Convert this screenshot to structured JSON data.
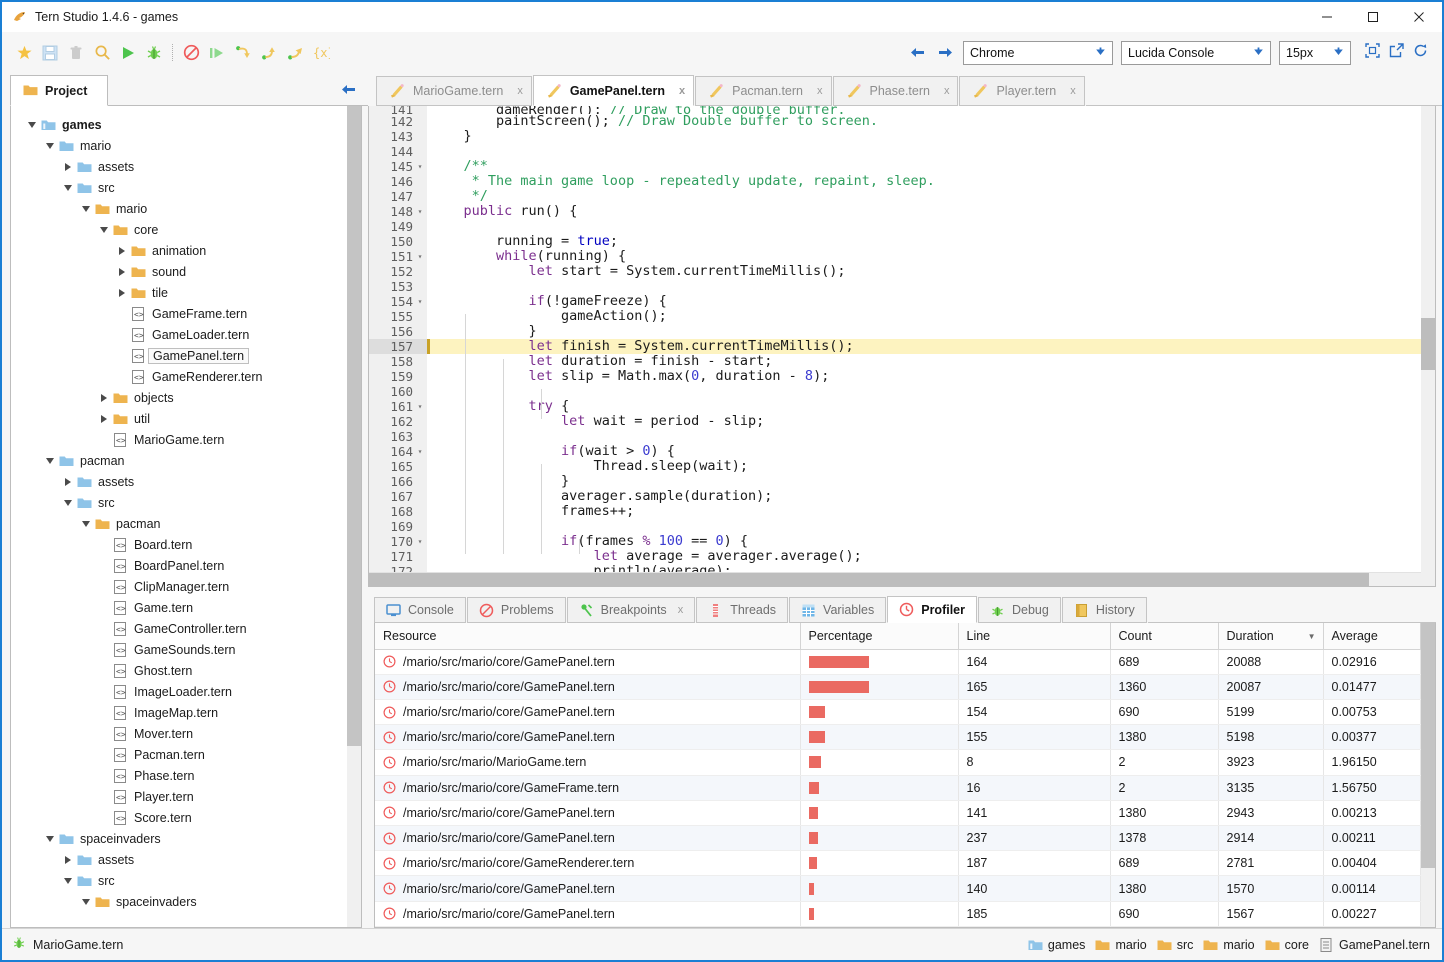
{
  "window": {
    "title": "Tern Studio 1.4.6 - games",
    "app_icon": "tern-bird-icon",
    "minimize_label": "—",
    "maximize_label": "□",
    "close_label": "✕"
  },
  "toolbar": {
    "icons": [
      {
        "name": "favorite-star-icon",
        "glyph": "star",
        "color": "#f5c242"
      },
      {
        "name": "save-icon",
        "glyph": "floppy",
        "color": "#cfe2f3"
      },
      {
        "name": "delete-icon",
        "glyph": "trash",
        "color": "#c9c9c9"
      },
      {
        "name": "search-icon",
        "glyph": "magnifier",
        "color": "#e8b84b"
      },
      {
        "name": "run-icon",
        "glyph": "play",
        "color": "#5cc45c"
      },
      {
        "name": "debug-icon",
        "glyph": "bug",
        "color": "#5cc45c"
      },
      {
        "name": "stop-icon",
        "glyph": "no-entry",
        "color": "#ef5b5b"
      },
      {
        "name": "resume-icon",
        "glyph": "resume",
        "color": "#8ed98e"
      },
      {
        "name": "step-over-icon",
        "glyph": "step-over",
        "color": "#5cc45c"
      },
      {
        "name": "step-in-icon",
        "glyph": "step-in",
        "color": "#5cc45c"
      },
      {
        "name": "step-out-icon",
        "glyph": "step-out",
        "color": "#5cc45c"
      },
      {
        "name": "evaluate-icon",
        "glyph": "braces-x",
        "color": "#f0c75e"
      }
    ],
    "nav_back": "◀",
    "nav_forward": "▶",
    "browser_select": {
      "value": "Chrome",
      "arrow": "⬇"
    },
    "font_select": {
      "value": "Lucida Console",
      "arrow": "⬇"
    },
    "size_select": {
      "value": "15px",
      "arrow": "⬇"
    },
    "right_icons": [
      {
        "name": "fit-window-icon"
      },
      {
        "name": "open-external-icon"
      },
      {
        "name": "refresh-icon"
      }
    ]
  },
  "sidebar": {
    "tab_label": "Project",
    "collapse_arrow": "◀",
    "tree": [
      {
        "depth": 0,
        "label": "games",
        "type": "root-folder",
        "state": "open",
        "bold": true
      },
      {
        "depth": 1,
        "label": "mario",
        "type": "blue-folder",
        "state": "open"
      },
      {
        "depth": 2,
        "label": "assets",
        "type": "blue-folder",
        "state": "closed"
      },
      {
        "depth": 2,
        "label": "src",
        "type": "blue-folder",
        "state": "open"
      },
      {
        "depth": 3,
        "label": "mario",
        "type": "pkg-folder",
        "state": "open"
      },
      {
        "depth": 4,
        "label": "core",
        "type": "pkg-folder",
        "state": "open"
      },
      {
        "depth": 5,
        "label": "animation",
        "type": "pkg-folder",
        "state": "closed"
      },
      {
        "depth": 5,
        "label": "sound",
        "type": "pkg-folder",
        "state": "closed"
      },
      {
        "depth": 5,
        "label": "tile",
        "type": "pkg-folder",
        "state": "closed"
      },
      {
        "depth": 5,
        "label": "GameFrame.tern",
        "type": "file",
        "state": "leaf"
      },
      {
        "depth": 5,
        "label": "GameLoader.tern",
        "type": "file",
        "state": "leaf"
      },
      {
        "depth": 5,
        "label": "GamePanel.tern",
        "type": "file",
        "state": "leaf",
        "selected": true
      },
      {
        "depth": 5,
        "label": "GameRenderer.tern",
        "type": "file",
        "state": "leaf"
      },
      {
        "depth": 4,
        "label": "objects",
        "type": "pkg-folder",
        "state": "closed"
      },
      {
        "depth": 4,
        "label": "util",
        "type": "pkg-folder",
        "state": "closed"
      },
      {
        "depth": 4,
        "label": "MarioGame.tern",
        "type": "file",
        "state": "leaf"
      },
      {
        "depth": 1,
        "label": "pacman",
        "type": "blue-folder",
        "state": "open"
      },
      {
        "depth": 2,
        "label": "assets",
        "type": "blue-folder",
        "state": "closed"
      },
      {
        "depth": 2,
        "label": "src",
        "type": "blue-folder",
        "state": "open"
      },
      {
        "depth": 3,
        "label": "pacman",
        "type": "pkg-folder",
        "state": "open"
      },
      {
        "depth": 4,
        "label": "Board.tern",
        "type": "file",
        "state": "leaf"
      },
      {
        "depth": 4,
        "label": "BoardPanel.tern",
        "type": "file",
        "state": "leaf"
      },
      {
        "depth": 4,
        "label": "ClipManager.tern",
        "type": "file",
        "state": "leaf"
      },
      {
        "depth": 4,
        "label": "Game.tern",
        "type": "file",
        "state": "leaf"
      },
      {
        "depth": 4,
        "label": "GameController.tern",
        "type": "file",
        "state": "leaf"
      },
      {
        "depth": 4,
        "label": "GameSounds.tern",
        "type": "file",
        "state": "leaf"
      },
      {
        "depth": 4,
        "label": "Ghost.tern",
        "type": "file",
        "state": "leaf"
      },
      {
        "depth": 4,
        "label": "ImageLoader.tern",
        "type": "file",
        "state": "leaf"
      },
      {
        "depth": 4,
        "label": "ImageMap.tern",
        "type": "file",
        "state": "leaf"
      },
      {
        "depth": 4,
        "label": "Mover.tern",
        "type": "file",
        "state": "leaf"
      },
      {
        "depth": 4,
        "label": "Pacman.tern",
        "type": "file",
        "state": "leaf"
      },
      {
        "depth": 4,
        "label": "Phase.tern",
        "type": "file",
        "state": "leaf"
      },
      {
        "depth": 4,
        "label": "Player.tern",
        "type": "file",
        "state": "leaf"
      },
      {
        "depth": 4,
        "label": "Score.tern",
        "type": "file",
        "state": "leaf"
      },
      {
        "depth": 1,
        "label": "spaceinvaders",
        "type": "blue-folder",
        "state": "open"
      },
      {
        "depth": 2,
        "label": "assets",
        "type": "blue-folder",
        "state": "closed"
      },
      {
        "depth": 2,
        "label": "src",
        "type": "blue-folder",
        "state": "open"
      },
      {
        "depth": 3,
        "label": "spaceinvaders",
        "type": "pkg-folder",
        "state": "open"
      }
    ]
  },
  "editor": {
    "tabs": [
      {
        "label": "MarioGame.tern",
        "active": false,
        "close": "x"
      },
      {
        "label": "GamePanel.tern",
        "active": true,
        "close": "x"
      },
      {
        "label": "Pacman.tern",
        "active": false,
        "close": "x"
      },
      {
        "label": "Phase.tern",
        "active": false,
        "close": "x"
      },
      {
        "label": "Player.tern",
        "active": false,
        "close": "x"
      }
    ],
    "first_line": 141,
    "current_line": 157,
    "lines": [
      {
        "n": 141,
        "clip": true,
        "html": "        <span class='x'>gameRender();</span> <span class='cmt'>// Draw to the double buffer.</span>"
      },
      {
        "n": 142,
        "html": "        paintScreen(); <span class='cmt'>// Draw Double buffer to screen.</span>"
      },
      {
        "n": 143,
        "html": "    }"
      },
      {
        "n": 144,
        "html": ""
      },
      {
        "n": 145,
        "fold": true,
        "html": "    <span class='cmt'>/**</span>"
      },
      {
        "n": 146,
        "html": "     <span class='cmt'>* The main game loop - repeatedly update, repaint, sleep.</span>"
      },
      {
        "n": 147,
        "html": "     <span class='cmt'>*/</span>"
      },
      {
        "n": 148,
        "fold": true,
        "html": "    <span class='kw'>public</span> run() {"
      },
      {
        "n": 149,
        "html": ""
      },
      {
        "n": 150,
        "html": "        running = <span class='kw2'>true</span>;"
      },
      {
        "n": 151,
        "fold": true,
        "html": "        <span class='kw'>while</span>(running) {"
      },
      {
        "n": 152,
        "html": "            <span class='kw'>let</span> start = System.currentTimeMillis();"
      },
      {
        "n": 153,
        "html": ""
      },
      {
        "n": 154,
        "fold": true,
        "html": "            <span class='kw'>if</span>(!gameFreeze) {"
      },
      {
        "n": 155,
        "html": "                gameAction();"
      },
      {
        "n": 156,
        "html": "            }"
      },
      {
        "n": 157,
        "hl": true,
        "html": "            <span class='kw'>let</span> finish = System.currentTimeMillis();"
      },
      {
        "n": 158,
        "html": "            <span class='kw'>let</span> duration = finish - start;"
      },
      {
        "n": 159,
        "html": "            <span class='kw'>let</span> slip = Math.max(<span class='num'>0</span>, duration - <span class='num'>8</span>);"
      },
      {
        "n": 160,
        "html": ""
      },
      {
        "n": 161,
        "fold": true,
        "html": "            <span class='kw'>try</span> {"
      },
      {
        "n": 162,
        "html": "                <span class='kw'>let</span> wait = period - slip;"
      },
      {
        "n": 163,
        "html": ""
      },
      {
        "n": 164,
        "fold": true,
        "html": "                <span class='kw'>if</span>(wait &gt; <span class='num'>0</span>) {"
      },
      {
        "n": 165,
        "html": "                    Thread.sleep(wait);"
      },
      {
        "n": 166,
        "html": "                }"
      },
      {
        "n": 167,
        "html": "                averager.sample(duration);"
      },
      {
        "n": 168,
        "html": "                frames++;"
      },
      {
        "n": 169,
        "html": ""
      },
      {
        "n": 170,
        "fold": true,
        "html": "                <span class='kw'>if</span>(frames <span class='kw'>%</span> <span class='num'>100</span> == <span class='num'>0</span>) {"
      },
      {
        "n": 171,
        "html": "                    <span class='kw'>let</span> average = averager.average();"
      },
      {
        "n": 172,
        "clipbottom": true,
        "html": "                    println(average);"
      }
    ]
  },
  "bottom_panel": {
    "tabs": [
      {
        "label": "Console",
        "icon": "console-icon",
        "active": false
      },
      {
        "label": "Problems",
        "icon": "problems-icon",
        "active": false
      },
      {
        "label": "Breakpoints",
        "icon": "breakpoints-icon",
        "active": false,
        "close": "x"
      },
      {
        "label": "Threads",
        "icon": "threads-icon",
        "active": false
      },
      {
        "label": "Variables",
        "icon": "variables-icon",
        "active": false
      },
      {
        "label": "Profiler",
        "icon": "profiler-icon",
        "active": true
      },
      {
        "label": "Debug",
        "icon": "debug-icon",
        "active": false
      },
      {
        "label": "History",
        "icon": "history-icon",
        "active": false
      }
    ],
    "table": {
      "columns": [
        "Resource",
        "Percentage",
        "Line",
        "Count",
        "Duration",
        "Average"
      ],
      "sorted_column": "Duration",
      "sort_marker": "▼",
      "rows": [
        {
          "resource": "/mario/src/mario/core/GamePanel.tern",
          "pct": 100,
          "line": "164",
          "count": "689",
          "duration": "20088",
          "average": "0.02916"
        },
        {
          "resource": "/mario/src/mario/core/GamePanel.tern",
          "pct": 100,
          "line": "165",
          "count": "1360",
          "duration": "20087",
          "average": "0.01477"
        },
        {
          "resource": "/mario/src/mario/core/GamePanel.tern",
          "pct": 26,
          "line": "154",
          "count": "690",
          "duration": "5199",
          "average": "0.00753"
        },
        {
          "resource": "/mario/src/mario/core/GamePanel.tern",
          "pct": 26,
          "line": "155",
          "count": "1380",
          "duration": "5198",
          "average": "0.00377"
        },
        {
          "resource": "/mario/src/mario/MarioGame.tern",
          "pct": 20,
          "line": "8",
          "count": "2",
          "duration": "3923",
          "average": "1.96150"
        },
        {
          "resource": "/mario/src/mario/core/GameFrame.tern",
          "pct": 16,
          "line": "16",
          "count": "2",
          "duration": "3135",
          "average": "1.56750"
        },
        {
          "resource": "/mario/src/mario/core/GamePanel.tern",
          "pct": 15,
          "line": "141",
          "count": "1380",
          "duration": "2943",
          "average": "0.00213"
        },
        {
          "resource": "/mario/src/mario/core/GamePanel.tern",
          "pct": 15,
          "line": "237",
          "count": "1378",
          "duration": "2914",
          "average": "0.00211"
        },
        {
          "resource": "/mario/src/mario/core/GameRenderer.tern",
          "pct": 14,
          "line": "187",
          "count": "689",
          "duration": "2781",
          "average": "0.00404"
        },
        {
          "resource": "/mario/src/mario/core/GamePanel.tern",
          "pct": 8,
          "line": "140",
          "count": "1380",
          "duration": "1570",
          "average": "0.00114"
        },
        {
          "resource": "/mario/src/mario/core/GamePanel.tern",
          "pct": 8,
          "line": "185",
          "count": "690",
          "duration": "1567",
          "average": "0.00227"
        }
      ]
    }
  },
  "statusbar": {
    "process_icon": "bug-icon",
    "process_label": "MarioGame.tern",
    "breadcrumb": [
      {
        "label": "games",
        "icon": "root-folder-icon"
      },
      {
        "label": "mario",
        "icon": "folder-icon"
      },
      {
        "label": "src",
        "icon": "folder-icon"
      },
      {
        "label": "mario",
        "icon": "folder-icon"
      },
      {
        "label": "core",
        "icon": "folder-icon"
      },
      {
        "label": "GamePanel.tern",
        "icon": "file-icon"
      }
    ]
  },
  "colors": {
    "accent": "#1a7fd4",
    "bar": "#ea6a62",
    "highlight": "#fdf3c0",
    "folder_blue": "#8fc4e8",
    "folder_orange": "#eeb44f"
  }
}
